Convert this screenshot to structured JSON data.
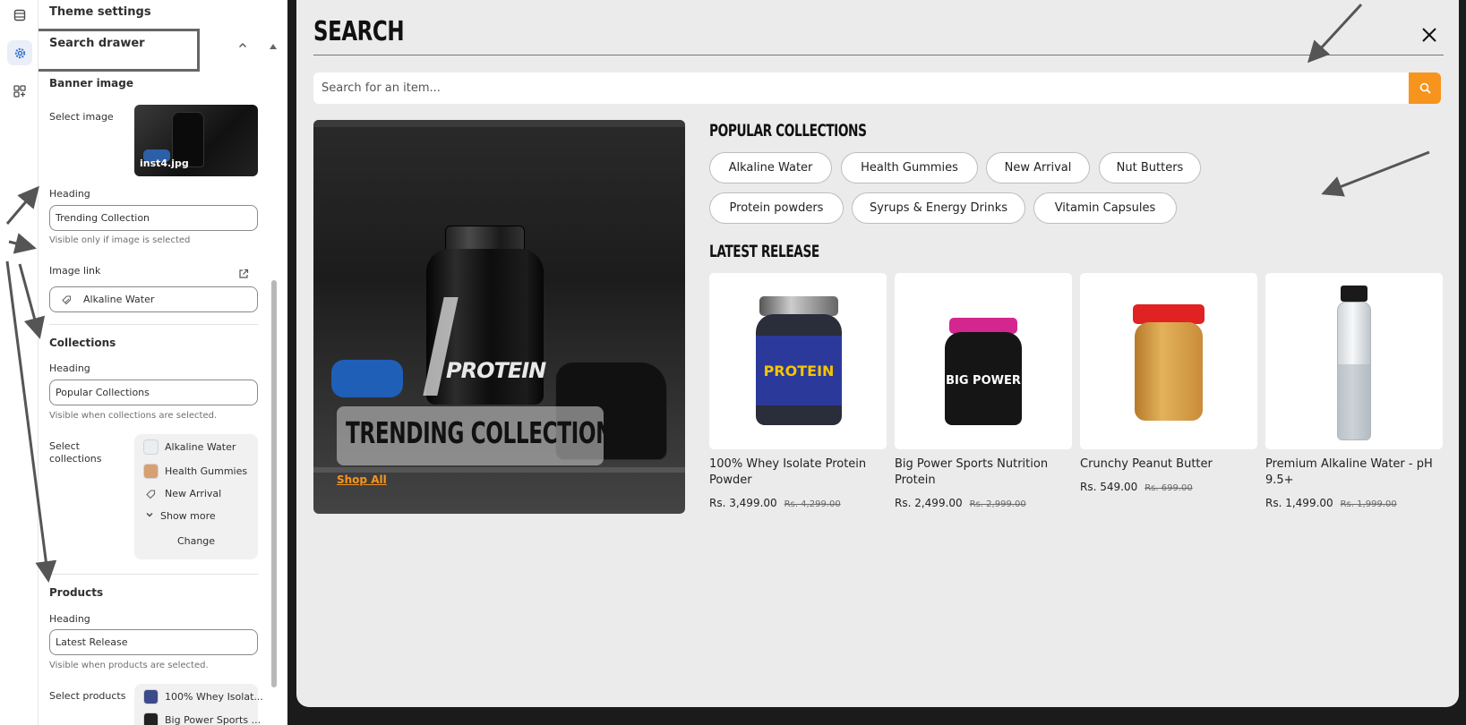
{
  "sidebar": {
    "theme_settings": "Theme settings",
    "section_title": "Search drawer",
    "banner_label": "Banner image",
    "select_image_label": "Select image",
    "image_filename": "inst4.jpg",
    "heading_label": "Heading",
    "banner_heading_value": "Trending Collection",
    "banner_help": "Visible only if image is selected",
    "image_link_label": "Image link",
    "image_link_value": "Alkaline Water",
    "collections_title": "Collections",
    "collections_heading_label": "Heading",
    "collections_heading_value": "Popular Collections",
    "collections_help": "Visible when collections are selected.",
    "select_collections_label": "Select collections",
    "selected_collections": [
      "Alkaline Water",
      "Health Gummies",
      "New Arrival"
    ],
    "show_more": "Show more",
    "change": "Change",
    "products_title": "Products",
    "products_heading_label": "Heading",
    "products_heading_value": "Latest Release",
    "products_help": "Visible when products are selected.",
    "select_products_label": "Select products",
    "selected_products": [
      "100% Whey Isolat...",
      "Big Power Sports ..."
    ]
  },
  "drawer": {
    "title": "SEARCH",
    "search_placeholder": "Search for an item...",
    "banner_heading": "TRENDING COLLECTION",
    "banner_link": "Shop All",
    "banner_product_text": "PROTEIN",
    "collections_heading": "POPULAR COLLECTIONS",
    "collections": [
      "Alkaline Water",
      "Health Gummies",
      "New Arrival",
      "Nut Butters",
      "Protein powders",
      "Syrups & Energy Drinks",
      "Vitamin Capsules"
    ],
    "products_heading": "LATEST RELEASE",
    "products": [
      {
        "title": "100% Whey Isolate Protein Powder",
        "price": "Rs. 3,499.00",
        "compare_price": "Rs. 4,299.00",
        "label": "PROTEIN"
      },
      {
        "title": "Big Power Sports Nutrition Protein",
        "price": "Rs. 2,499.00",
        "compare_price": "Rs. 2,999.00",
        "label": "BIG POWER"
      },
      {
        "title": "Crunchy Peanut Butter",
        "price": "Rs. 549.00",
        "compare_price": "Rs. 699.00",
        "label": ""
      },
      {
        "title": "Premium Alkaline Water - pH 9.5+",
        "price": "Rs. 1,499.00",
        "compare_price": "Rs. 1,999.00",
        "label": ""
      }
    ]
  },
  "colors": {
    "accent": "#f7941d",
    "drawer_bg": "#ebebec",
    "text": "#111111"
  },
  "icons": [
    "layout-icon",
    "gear-icon",
    "apps-icon",
    "chevron-up-icon",
    "external-link-icon",
    "link-icon",
    "chevron-down-icon",
    "close-icon",
    "search-icon"
  ]
}
